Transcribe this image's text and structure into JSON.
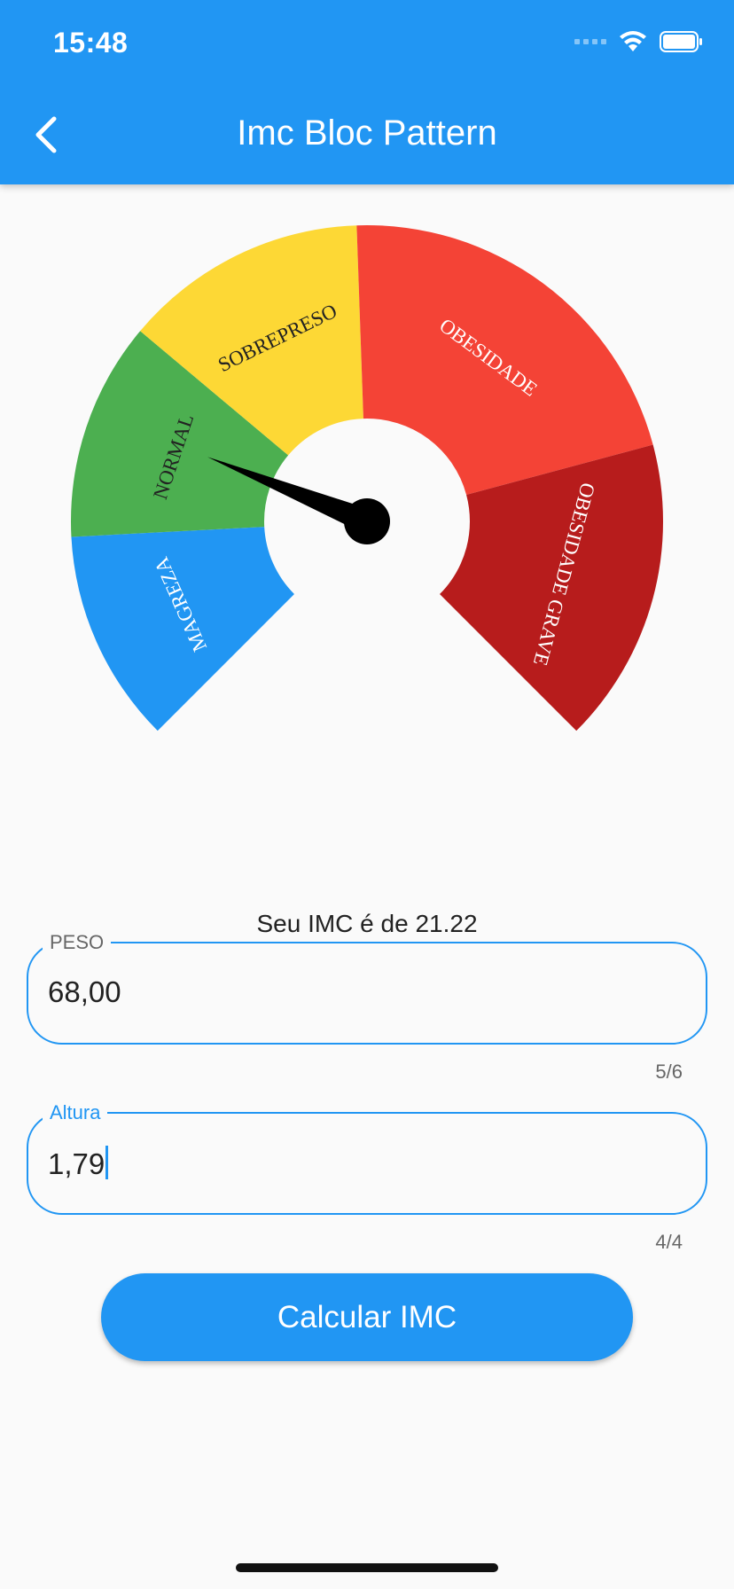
{
  "status_bar": {
    "time": "15:48"
  },
  "app_bar": {
    "title": "Imc Bloc Pattern"
  },
  "gauge": {
    "segments": [
      {
        "label": "MAGREZA",
        "color": "#2196f3"
      },
      {
        "label": "NORMAL",
        "color": "#4caf50"
      },
      {
        "label": "SOBREPRESO",
        "color": "#fdd835"
      },
      {
        "label": "OBESIDADE",
        "color": "#f44336"
      },
      {
        "label": "OBESIDADE GRAVE",
        "color": "#b71c1c"
      }
    ],
    "pointer_value": 21.22
  },
  "result": {
    "text": "Seu IMC é de 21.22"
  },
  "form": {
    "peso": {
      "label": "PESO",
      "value": "68,00",
      "counter": "5/6"
    },
    "altura": {
      "label": "Altura",
      "value": "1,79",
      "counter": "4/4"
    }
  },
  "button": {
    "label": "Calcular IMC"
  },
  "colors": {
    "primary": "#2196f3",
    "label_inactive": "#666666"
  }
}
